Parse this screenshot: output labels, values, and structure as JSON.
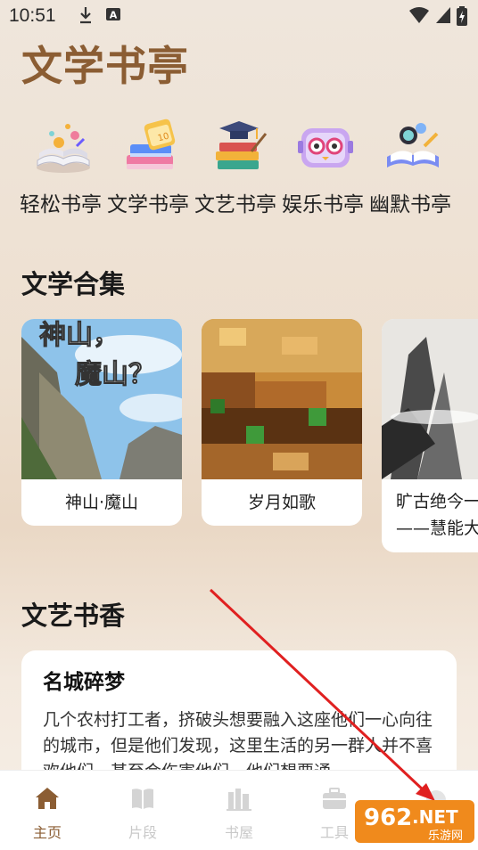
{
  "status_bar": {
    "time": "10:51"
  },
  "app": {
    "title": "文学书亭"
  },
  "categories": [
    {
      "label": "轻松书亭",
      "icon": "book-magic-icon"
    },
    {
      "label": "文学书亭",
      "icon": "book-stack-calendar-icon"
    },
    {
      "label": "文艺书亭",
      "icon": "graduation-books-icon"
    },
    {
      "label": "娱乐书亭",
      "icon": "robot-glasses-icon"
    },
    {
      "label": "幽默书亭",
      "icon": "open-book-rocket-icon"
    }
  ],
  "collection": {
    "title": "文学合集",
    "items": [
      {
        "label": "神山·魔山",
        "cover_text": "神山，魔山？"
      },
      {
        "label": "岁月如歌"
      },
      {
        "label_line1": "旷古绝今一",
        "label_line2": "——慧能大"
      }
    ]
  },
  "literary": {
    "title": "文艺书香",
    "article": {
      "title": "名城碎梦",
      "body": "几个农村打工者，挤破头想要融入这座他们一心向往的城市，但是他们发现，这里生活的另一群人并不喜欢他们，甚至会伤害他们，他们想要通"
    }
  },
  "bottom_nav": [
    {
      "label": "主页",
      "icon": "home-icon",
      "active": true
    },
    {
      "label": "片段",
      "icon": "book-icon",
      "active": false
    },
    {
      "label": "书屋",
      "icon": "bookshelf-icon",
      "active": false
    },
    {
      "label": "工具",
      "icon": "toolbox-icon",
      "active": false
    }
  ],
  "watermark": {
    "brand": "962.NET",
    "subtitle": "乐游网"
  },
  "colors": {
    "accent": "#8b5d33",
    "arrow": "#e02020"
  }
}
